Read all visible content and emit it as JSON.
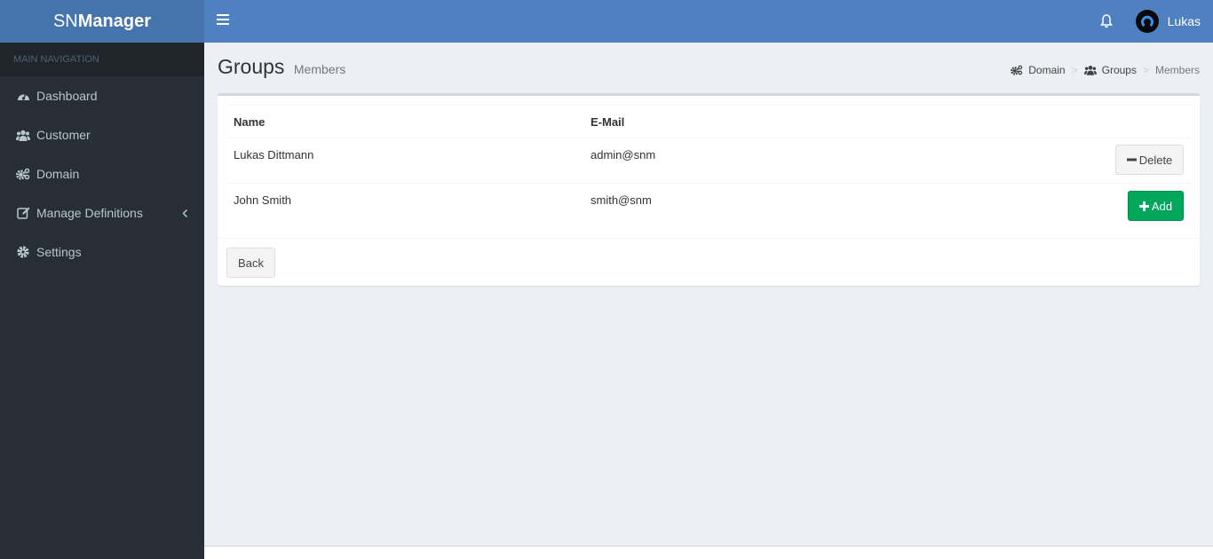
{
  "app": {
    "logo_prefix": "SN",
    "logo_suffix": "Manager"
  },
  "header": {
    "toggle_icon": "hamburger-icon",
    "notifications_icon": "bell-icon",
    "user": {
      "name": "Lukas",
      "avatar_icon": "user-avatar-icon"
    }
  },
  "sidebar": {
    "header": "MAIN NAVIGATION",
    "items": [
      {
        "label": "Dashboard",
        "icon": "dashboard-icon"
      },
      {
        "label": "Customer",
        "icon": "users-icon"
      },
      {
        "label": "Domain",
        "icon": "cogs-icon"
      },
      {
        "label": "Manage Definitions",
        "icon": "edit-icon",
        "has_submenu": true
      },
      {
        "label": "Settings",
        "icon": "gear-icon"
      }
    ]
  },
  "page": {
    "title": "Groups",
    "subtitle": "Members",
    "breadcrumb": [
      {
        "label": "Domain",
        "icon": "cogs-icon"
      },
      {
        "label": "Groups",
        "icon": "users-icon"
      },
      {
        "label": "Members"
      }
    ],
    "breadcrumb_separator": ">"
  },
  "table": {
    "columns": [
      "Name",
      "E-Mail"
    ],
    "rows": [
      {
        "name": "Lukas Dittmann",
        "email": "admin@snm",
        "action": "Delete"
      },
      {
        "name": "John Smith",
        "email": "smith@snm",
        "action": "Add"
      }
    ]
  },
  "footer_actions": {
    "back_label": "Back"
  },
  "colors": {
    "header": "#4f80c1",
    "logo_bg": "#4574ac",
    "sidebar_bg": "#272e36",
    "add_button": "#00a65a"
  }
}
